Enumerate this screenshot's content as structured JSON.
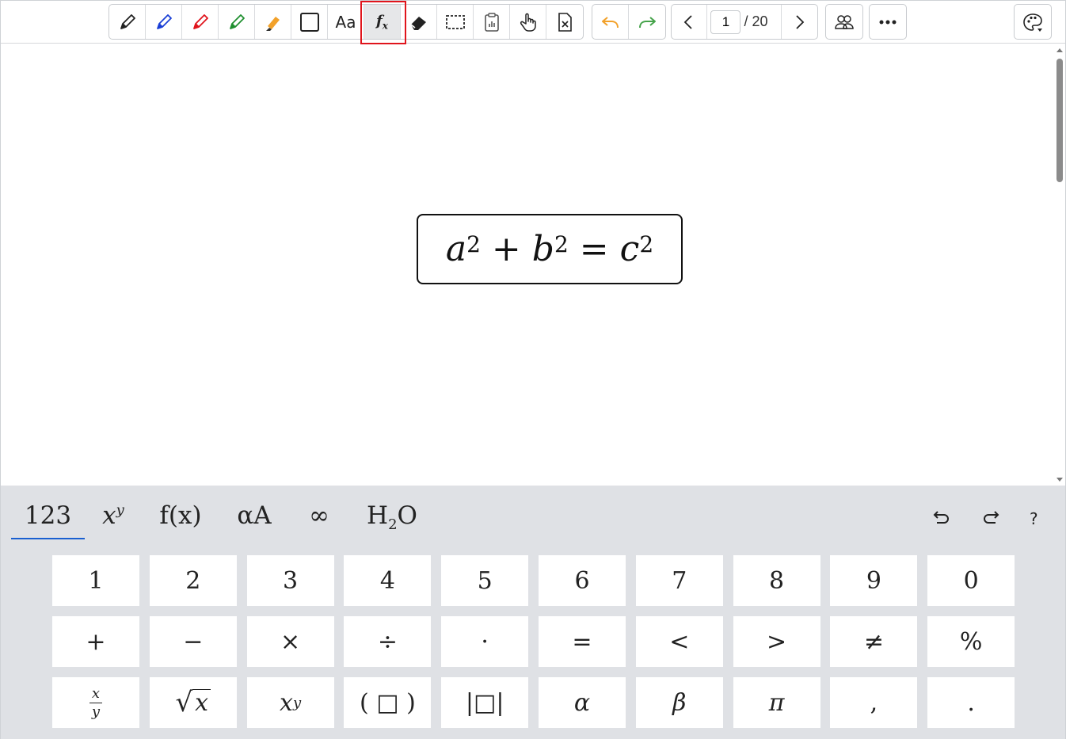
{
  "toolbar": {
    "tools": [
      {
        "name": "pencil-black",
        "color": "#222222"
      },
      {
        "name": "pencil-blue",
        "color": "#1a3fd6"
      },
      {
        "name": "pencil-red",
        "color": "#e0141c"
      },
      {
        "name": "pencil-green",
        "color": "#1f8f2f"
      },
      {
        "name": "highlighter",
        "color": "#f2a12a"
      },
      {
        "name": "shape-rectangle"
      },
      {
        "name": "text"
      },
      {
        "name": "formula",
        "active": true
      },
      {
        "name": "eraser"
      },
      {
        "name": "select-region"
      },
      {
        "name": "clipboard"
      },
      {
        "name": "pan-hand"
      },
      {
        "name": "clear-page"
      }
    ],
    "text_label": "Aa",
    "formula_label": "f",
    "formula_sub": "x",
    "undo_color": "#f2a12a",
    "redo_color": "#45a34a",
    "page_current": "1",
    "page_total": "/ 20",
    "accent_active_outline": "#e0141c"
  },
  "canvas": {
    "formula": {
      "a": "a",
      "a_exp": "2",
      "plus": "+",
      "b": "b",
      "b_exp": "2",
      "eq": "=",
      "c": "c",
      "c_exp": "2"
    }
  },
  "keyboard": {
    "tabs": {
      "numbers": "123",
      "power_base": "x",
      "power_exp": "y",
      "functions": "f(x)",
      "greek": "αA",
      "infinity": "∞",
      "chem_h": "H",
      "chem_sub": "2",
      "chem_o": "O"
    },
    "selected_tab_color": "#1a5fd0",
    "actions": {
      "undo": "⮌",
      "redo": "⮎",
      "help": "?"
    },
    "rows": [
      [
        "1",
        "2",
        "3",
        "4",
        "5",
        "6",
        "7",
        "8",
        "9",
        "0"
      ],
      [
        "+",
        "−",
        "×",
        "÷",
        "·",
        "=",
        "<",
        ">",
        "≠",
        "%"
      ],
      [
        "x/y",
        "√x",
        "x^y",
        "( □ )",
        "|□|",
        "α",
        "β",
        "π",
        ",",
        "."
      ]
    ],
    "fraction_num": "x",
    "fraction_den": "y",
    "sqrt_symbol": "√",
    "sqrt_arg": "x",
    "power_base": "x",
    "power_exp": "y",
    "paren_box": "( □ )",
    "abs_box": "|□|",
    "alpha": "α",
    "beta": "β",
    "pi": "π",
    "comma": ",",
    "period": "."
  }
}
